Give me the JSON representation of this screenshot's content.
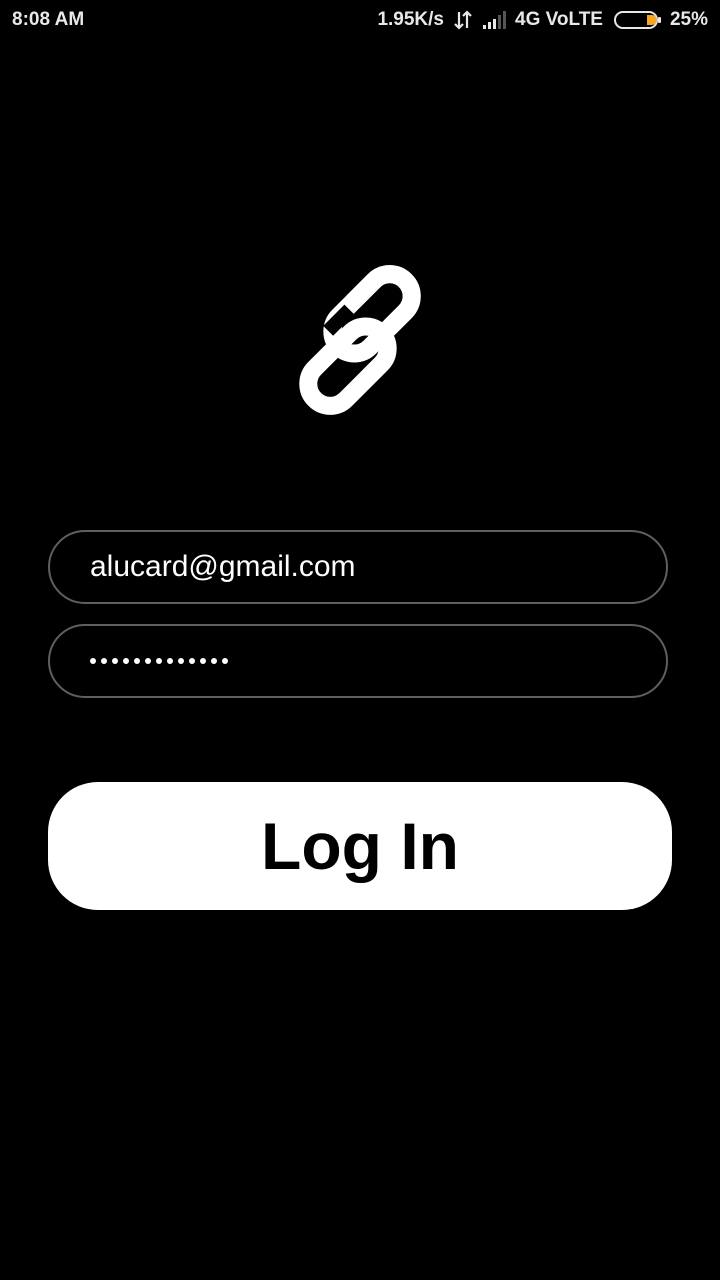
{
  "status_bar": {
    "time": "8:08 AM",
    "speed": "1.95K/s",
    "network": "4G VoLTE",
    "battery": "25%",
    "battery_fill_percent": 25,
    "battery_color": "#f5a623"
  },
  "logo": {
    "icon": "chain-link-icon"
  },
  "form": {
    "email_value": "alucard@gmail.com",
    "password_length": 13,
    "login_label": "Log In"
  },
  "colors": {
    "background": "#000000",
    "field_border": "#5f5f5f",
    "button_bg": "#ffffff",
    "button_text": "#000000"
  }
}
